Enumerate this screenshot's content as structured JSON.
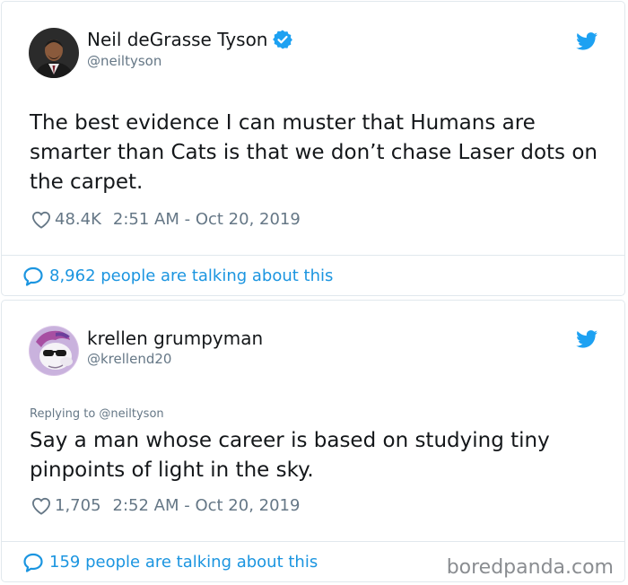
{
  "tweets": [
    {
      "author_name": "Neil deGrasse Tyson",
      "verified": true,
      "handle": "@neiltyson",
      "replying_to": "",
      "text": "The best evidence I can muster that Humans are smarter than Cats is that we don’t chase Laser dots on the carpet.",
      "likes": "48.4K",
      "timestamp": "2:51 AM - Oct 20, 2019",
      "talking": "8,962 people are talking about this",
      "avatar_icon": "avatar-man-in-suit",
      "bird_icon": "twitter-bird-icon"
    },
    {
      "author_name": "krellen grumpyman",
      "verified": false,
      "handle": "@krellend20",
      "replying_to": "Replying to @neiltyson",
      "text": "Say a man whose career is based on studying tiny pinpoints of light in the sky.",
      "likes": "1,705",
      "timestamp": "2:52 AM - Oct 20, 2019",
      "talking": "159 people are talking about this",
      "avatar_icon": "avatar-cartoon-pony-sunglasses",
      "bird_icon": "twitter-bird-icon"
    }
  ],
  "watermark": "boredpanda.com",
  "colors": {
    "link": "#1b95e0",
    "muted": "#657786",
    "text": "#14171a",
    "border": "#e1e8ed"
  }
}
